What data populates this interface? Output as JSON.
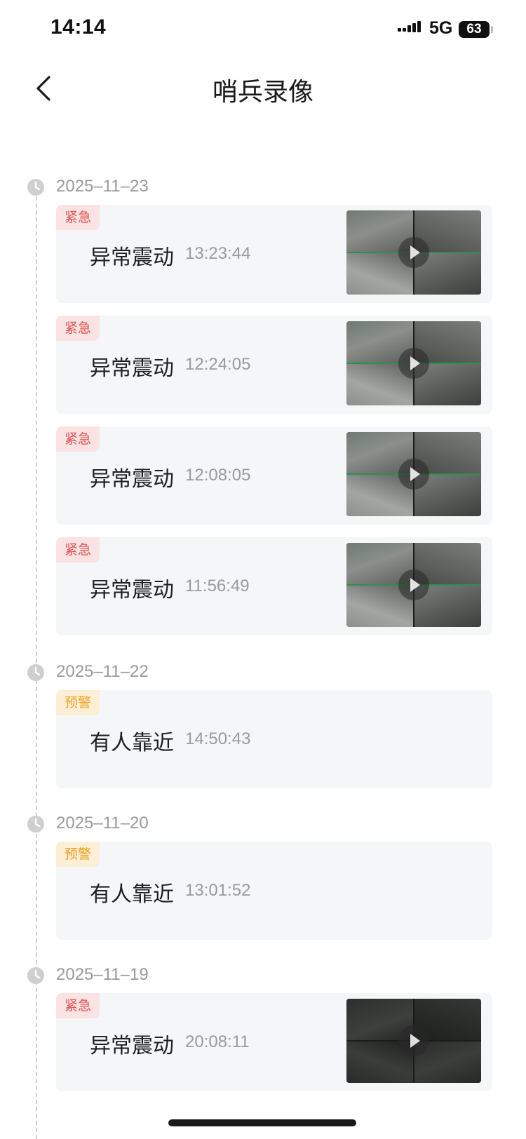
{
  "status_bar": {
    "time": "14:14",
    "network": "5G",
    "battery": "63"
  },
  "header": {
    "title": "哨兵录像",
    "back_icon": "chevron-left-icon"
  },
  "groups": [
    {
      "date": "2025–11–23",
      "events": [
        {
          "tag": "紧急",
          "tag_type": "urgent",
          "title": "异常震动",
          "time": "13:23:44",
          "has_thumbnail": true
        },
        {
          "tag": "紧急",
          "tag_type": "urgent",
          "title": "异常震动",
          "time": "12:24:05",
          "has_thumbnail": true
        },
        {
          "tag": "紧急",
          "tag_type": "urgent",
          "title": "异常震动",
          "time": "12:08:05",
          "has_thumbnail": true
        },
        {
          "tag": "紧急",
          "tag_type": "urgent",
          "title": "异常震动",
          "time": "11:56:49",
          "has_thumbnail": true
        }
      ]
    },
    {
      "date": "2025–11–22",
      "events": [
        {
          "tag": "预警",
          "tag_type": "warning",
          "title": "有人靠近",
          "time": "14:50:43",
          "has_thumbnail": false
        }
      ]
    },
    {
      "date": "2025–11–20",
      "events": [
        {
          "tag": "预警",
          "tag_type": "warning",
          "title": "有人靠近",
          "time": "13:01:52",
          "has_thumbnail": false
        }
      ]
    },
    {
      "date": "2025–11–19",
      "events": [
        {
          "tag": "紧急",
          "tag_type": "urgent",
          "title": "异常震动",
          "time": "20:08:11",
          "has_thumbnail": true,
          "thumbnail_style": "night"
        }
      ]
    }
  ],
  "colors": {
    "urgent_text": "#e05252",
    "urgent_bg": "#fbe3e3",
    "warning_text": "#f0a024",
    "warning_bg": "#fcefd6",
    "card_bg": "#f5f6f8"
  }
}
